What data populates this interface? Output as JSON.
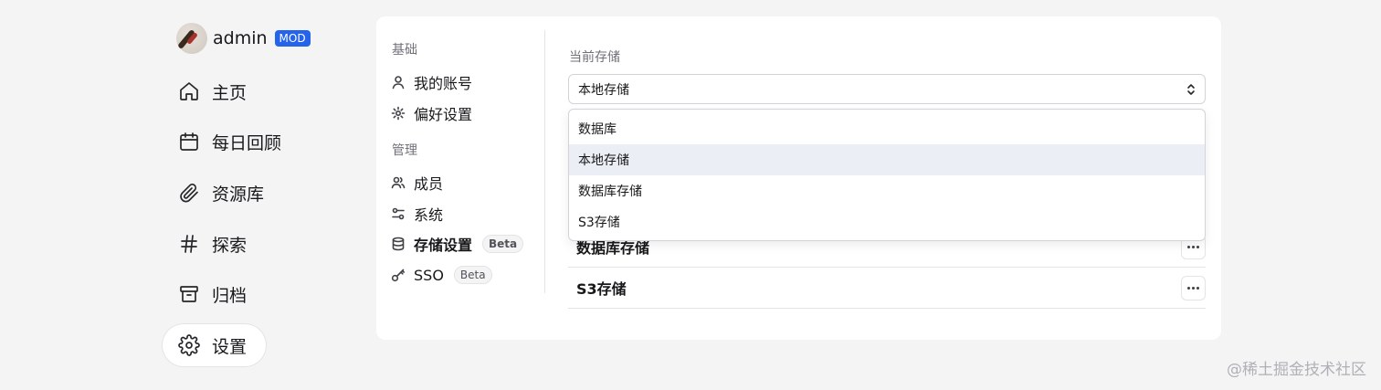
{
  "user": {
    "name": "admin",
    "badge": "MOD"
  },
  "nav": [
    {
      "label": "主页",
      "icon": "home-icon"
    },
    {
      "label": "每日回顾",
      "icon": "calendar-icon"
    },
    {
      "label": "资源库",
      "icon": "paperclip-icon"
    },
    {
      "label": "探索",
      "icon": "hash-icon"
    },
    {
      "label": "归档",
      "icon": "archive-icon"
    },
    {
      "label": "设置",
      "icon": "gear-icon",
      "active": true
    }
  ],
  "settings_menu": {
    "basic_title": "基础",
    "basic_items": [
      {
        "label": "我的账号",
        "icon": "user-icon"
      },
      {
        "label": "偏好设置",
        "icon": "gear-icon"
      }
    ],
    "admin_title": "管理",
    "admin_items": [
      {
        "label": "成员",
        "icon": "users-icon"
      },
      {
        "label": "系统",
        "icon": "sliders-icon"
      },
      {
        "label": "存储设置",
        "icon": "database-icon",
        "badge": "Beta",
        "active": true
      },
      {
        "label": "SSO",
        "icon": "key-icon",
        "badge": "Beta"
      }
    ]
  },
  "storage": {
    "current_label": "当前存储",
    "current_value": "本地存储",
    "options": [
      "数据库",
      "本地存储",
      "数据库存储",
      "S3存储"
    ],
    "highlighted_option": "本地存储",
    "list": [
      "数据库存储",
      "S3存储"
    ]
  },
  "watermark": "@稀土掘金技术社区",
  "colors": {
    "accent": "#2563eb",
    "background": "#f4f4f5",
    "card": "#ffffff"
  }
}
